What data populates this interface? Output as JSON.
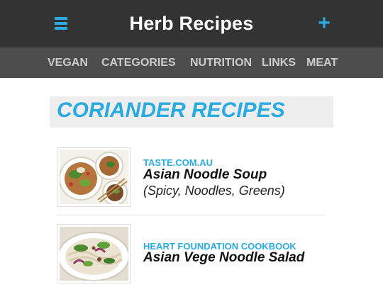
{
  "header": {
    "title": "Herb Recipes",
    "menu_icon": "hamburger-menu-icon",
    "add_icon": "plus-icon",
    "accent_color": "#29abe2"
  },
  "nav": {
    "items": [
      {
        "label": "VEGAN"
      },
      {
        "label": "CATEGORIES"
      },
      {
        "label": "NUTRITION"
      },
      {
        "label": "LINKS"
      },
      {
        "label": "MEAT"
      }
    ]
  },
  "section": {
    "title": "CORIANDER RECIPES"
  },
  "recipes": [
    {
      "source": "TASTE.COM.AU",
      "name": "Asian Noodle Soup",
      "tags": "(Spicy, Noodles, Greens)",
      "image": "noodle-soup-photo"
    },
    {
      "source": "HEART FOUNDATION COOKBOOK",
      "name": "Asian Vege Noodle Salad",
      "image": "noodle-salad-photo"
    }
  ]
}
